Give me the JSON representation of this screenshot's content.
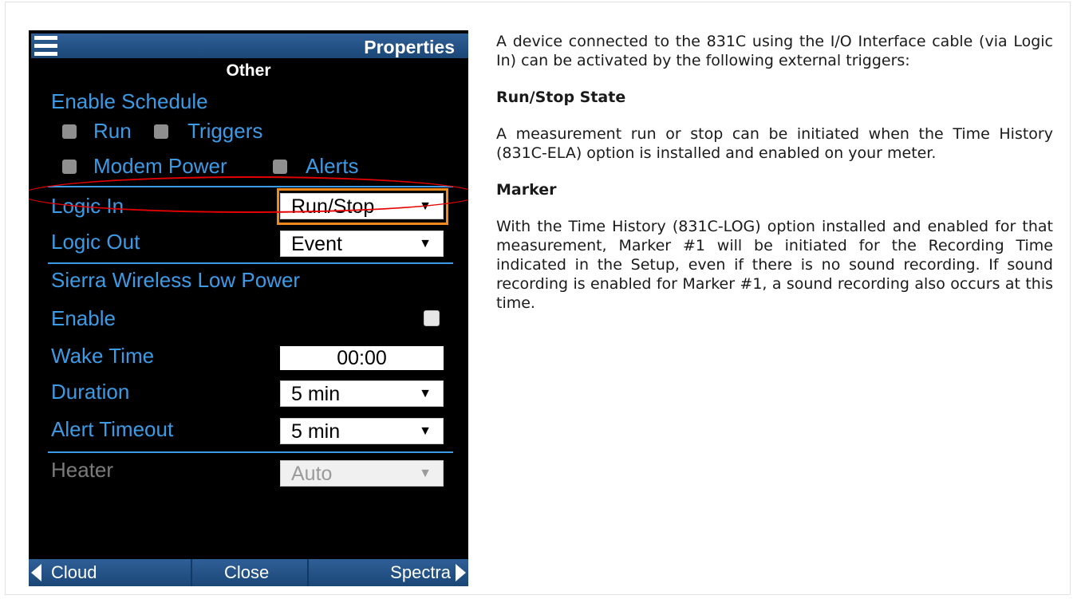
{
  "device": {
    "title": "Properties",
    "section": "Other",
    "enable_schedule": {
      "label": "Enable Schedule",
      "options": [
        "Run",
        "Triggers",
        "Modem Power",
        "Alerts"
      ]
    },
    "logic_in": {
      "label": "Logic In",
      "value": "Run/Stop"
    },
    "logic_out": {
      "label": "Logic Out",
      "value": "Event"
    },
    "sierra_header": "Sierra Wireless Low Power",
    "enable": {
      "label": "Enable",
      "checked": false
    },
    "wake_time": {
      "label": "Wake Time",
      "value": "00:00"
    },
    "duration": {
      "label": "Duration",
      "value": "5 min"
    },
    "alert_timeout": {
      "label": "Alert Timeout",
      "value": "5 min"
    },
    "heater": {
      "label": "Heater",
      "value": "Auto",
      "disabled": true
    },
    "bottom_nav": {
      "left": "Cloud",
      "center": "Close",
      "right": "Spectra"
    },
    "colors": {
      "accent": "#3d9be6",
      "bar": "#1f4a7c",
      "highlight": "#f08a1e",
      "annotation": "#e60000"
    }
  },
  "doc": {
    "intro": "A device connected to the 831C using the I/O Interface cable (via Logic In) can be activated by the following external triggers:",
    "h1": "Run/Stop State",
    "p1": "A measurement run or stop can be initiated when the Time History (831C-ELA) option is installed and enabled on your meter.",
    "h2": "Marker",
    "p2": "With the Time History (831C-LOG) option installed and enabled for that measurement, Marker #1 will be initiated for the Recording Time indicated in the Setup, even if there is no sound recording. If sound recording is enabled for Marker #1, a sound recording also occurs at this time."
  }
}
